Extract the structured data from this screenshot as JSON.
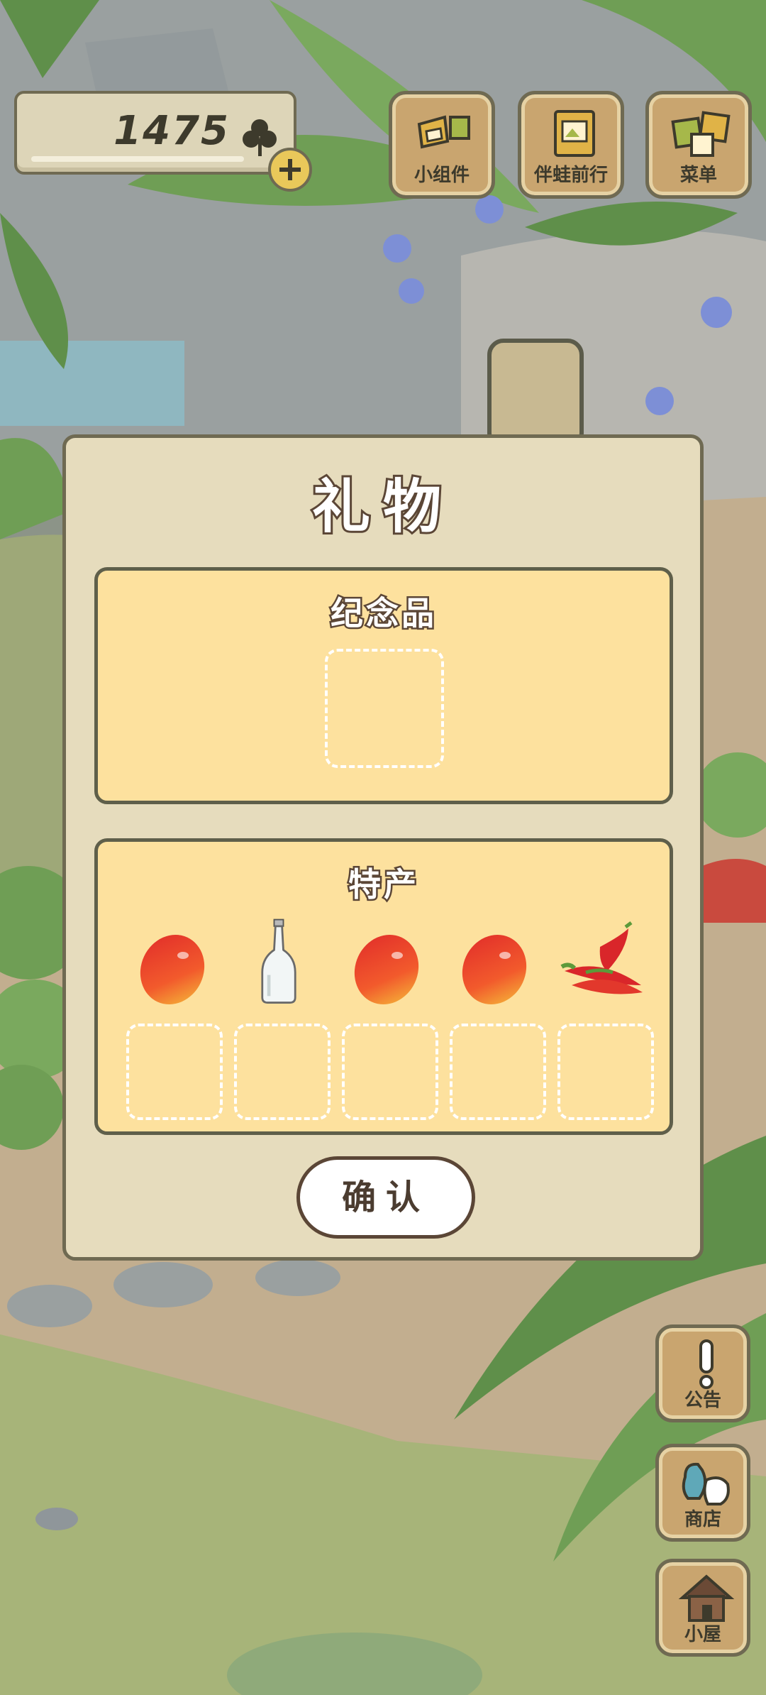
{
  "hud": {
    "clover_count": "1475"
  },
  "top_buttons": [
    {
      "label": "小组件"
    },
    {
      "label": "伴蛙前行"
    },
    {
      "label": "菜单"
    }
  ],
  "side_buttons": [
    {
      "label": "公告"
    },
    {
      "label": "商店"
    },
    {
      "label": "小屋"
    }
  ],
  "gift_dialog": {
    "title": "礼物",
    "souvenir_section": {
      "title": "纪念品",
      "slots": 1
    },
    "specialty_section": {
      "title": "特产",
      "items": [
        "mango-icon",
        "glass-bottle-icon",
        "mango-icon",
        "mango-icon",
        "chili-pepper-icon"
      ]
    },
    "confirm_label": "确认"
  },
  "colors": {
    "panel_fill": "#fde19e",
    "dialog_fill": "#e6dcbd",
    "outline": "#6f6a52",
    "wood_button": "#c9a56f"
  }
}
